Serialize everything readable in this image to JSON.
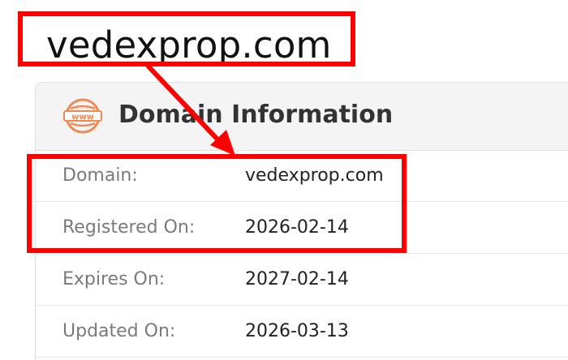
{
  "heading": {
    "domain": "vedexprop.com"
  },
  "card": {
    "title": "Domain Information",
    "icon_text": "www",
    "rows": [
      {
        "label": "Domain:",
        "value": "vedexprop.com"
      },
      {
        "label": "Registered On:",
        "value": "2026-02-14"
      },
      {
        "label": "Expires On:",
        "value": "2027-02-14"
      },
      {
        "label": "Updated On:",
        "value": "2026-03-13"
      }
    ]
  },
  "colors": {
    "annotation": "#ff0000",
    "icon": "#f08a55",
    "header_bg": "#f4f4f4"
  }
}
